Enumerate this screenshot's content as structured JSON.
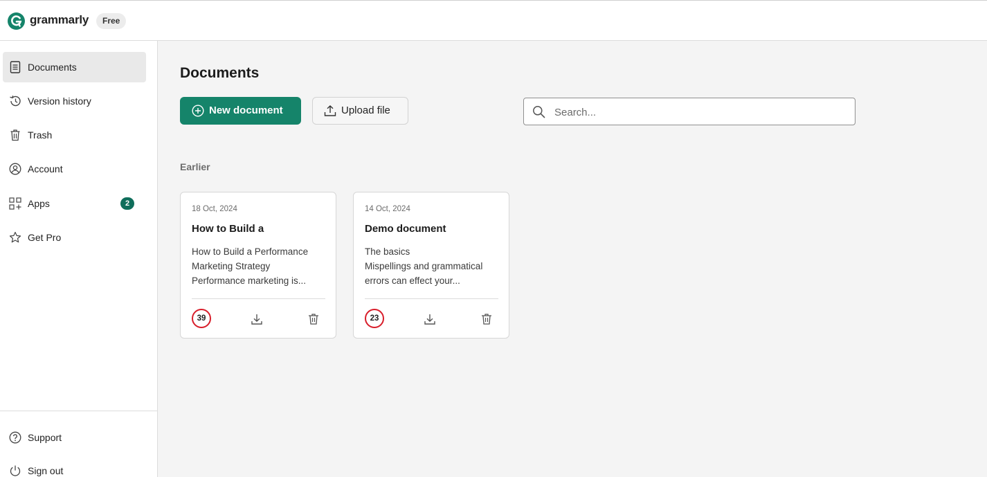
{
  "header": {
    "logo_text": "grammarly",
    "plan_badge": "Free"
  },
  "sidebar": {
    "items": [
      {
        "label": "Documents",
        "icon": "document-icon",
        "active": true
      },
      {
        "label": "Version history",
        "icon": "history-icon"
      },
      {
        "label": "Trash",
        "icon": "trash-icon"
      },
      {
        "label": "Account",
        "icon": "account-icon"
      },
      {
        "label": "Apps",
        "icon": "apps-icon",
        "count": "2"
      },
      {
        "label": "Get Pro",
        "icon": "star-icon"
      }
    ],
    "footer_items": [
      {
        "label": "Support",
        "icon": "help-icon"
      },
      {
        "label": "Sign out",
        "icon": "power-icon"
      }
    ]
  },
  "main": {
    "title": "Documents",
    "new_document_label": "New document",
    "upload_label": "Upload file",
    "search_placeholder": "Search...",
    "section_label": "Earlier",
    "documents": [
      {
        "date": "18 Oct, 2024",
        "title": "How to Build a",
        "excerpt": [
          "How to Build a Performance",
          "Marketing Strategy",
          "Performance marketing is..."
        ],
        "score": "39"
      },
      {
        "date": "14 Oct, 2024",
        "title": "Demo document",
        "excerpt": [
          "The basics",
          "Mispellings and grammatical",
          "errors can effect your..."
        ],
        "score": "23"
      }
    ]
  },
  "colors": {
    "brand_green": "#15846a",
    "badge_green": "#0f6e5b",
    "score_ring": "#d81d2a"
  }
}
